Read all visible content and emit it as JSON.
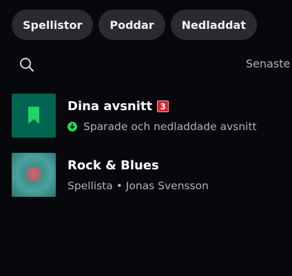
{
  "filters": [
    {
      "label": "Spellistor"
    },
    {
      "label": "Poddar"
    },
    {
      "label": "Nedladdat"
    }
  ],
  "toolbar": {
    "search_icon": "search-icon",
    "sort_label": "Senaste"
  },
  "library": {
    "items": [
      {
        "title": "Dina avsnitt",
        "badge": "3",
        "subtitle": "Sparade och nedladdade avsnitt",
        "icon": "bookmark-icon",
        "status_icon": "downloaded-icon",
        "thumb_color": "#006450"
      },
      {
        "title": "Rock & Blues",
        "subtitle": "Spellista • Jonas Svensson",
        "type": "playlist"
      }
    ]
  },
  "colors": {
    "background": "#07080b",
    "chip_bg": "#2a2b2e",
    "accent_green": "#1ed760",
    "badge_red": "#d8262c",
    "secondary_text": "#b3b3b3"
  }
}
